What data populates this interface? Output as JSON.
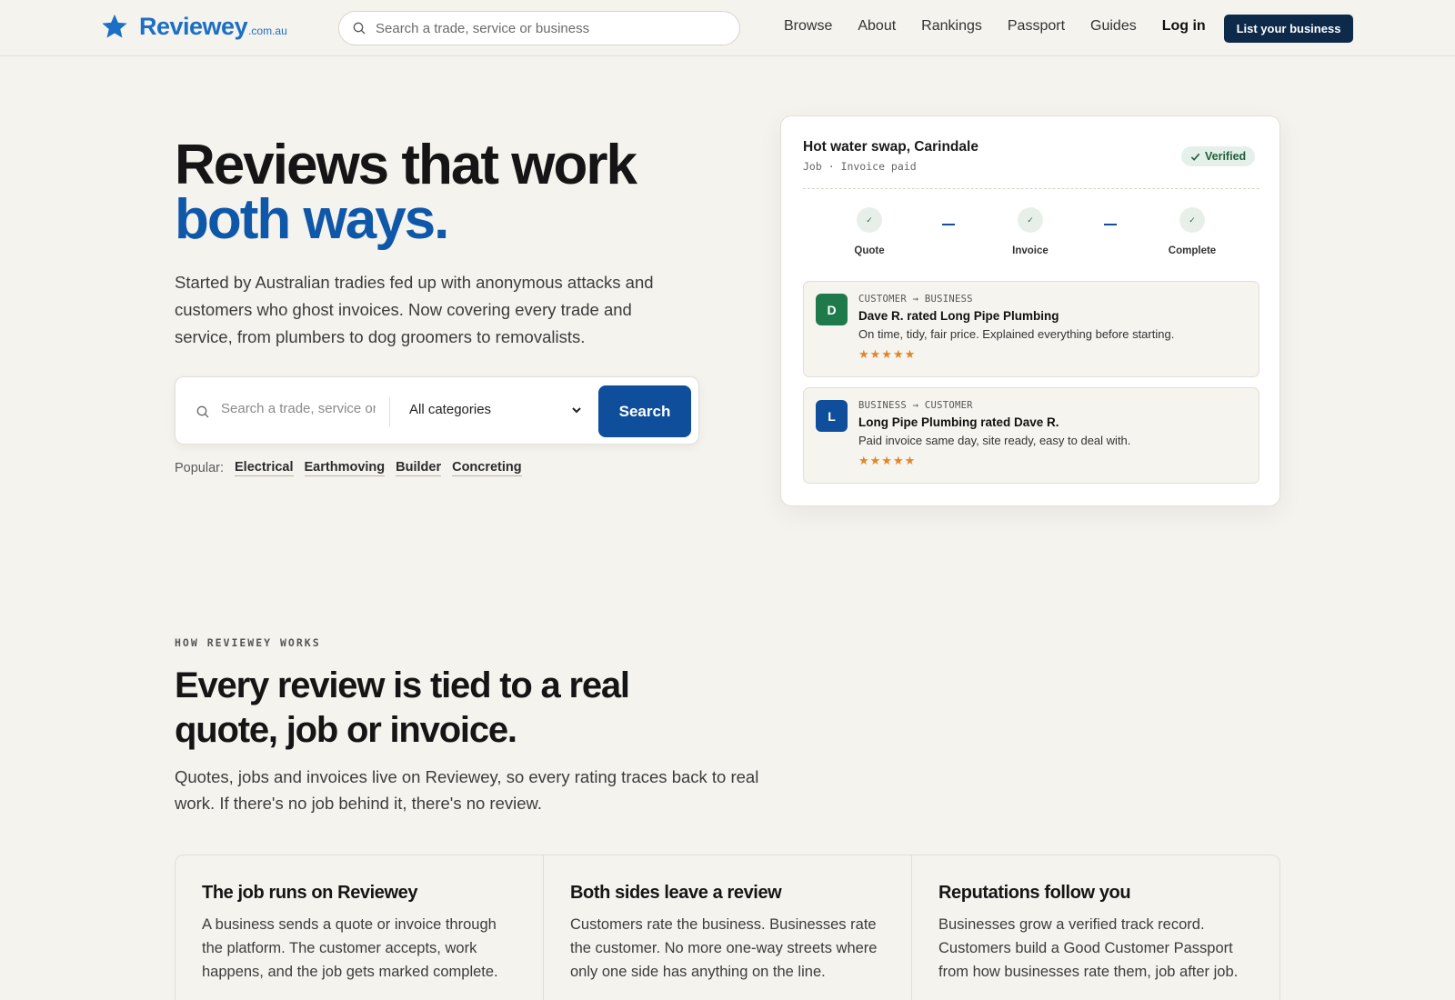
{
  "brand": {
    "name": "Reviewey",
    "tld": ".com.au",
    "color": "#1b6fc4"
  },
  "header": {
    "search_placeholder": "Search a trade, service or business",
    "nav": [
      "Browse",
      "About",
      "Rankings",
      "Passport",
      "Guides"
    ],
    "login": "Log in",
    "cta": "List your business"
  },
  "hero": {
    "title_line1": "Reviews that work",
    "title_line2": "both ways.",
    "subtitle": "Started by Australian tradies fed up with anonymous attacks and customers who ghost invoices. Now covering every trade and service, from plumbers to dog groomers to removalists.",
    "search_placeholder": "Search a trade, service or business",
    "category_selected": "All categories",
    "search_button": "Search",
    "popular_label": "Popular:",
    "popular": [
      "Electrical",
      "Earthmoving",
      "Builder",
      "Concreting"
    ]
  },
  "job_card": {
    "title": "Hot water swap, Carindale",
    "meta": "Job · Invoice paid",
    "badge": "Verified",
    "steps": [
      "Quote",
      "Invoice",
      "Complete"
    ],
    "reviews": [
      {
        "initial": "D",
        "avatar_color": "#1e7a4a",
        "tag": "CUSTOMER → BUSINESS",
        "headline": "Dave R. rated Long Pipe Plumbing",
        "body": "On time, tidy, fair price. Explained everything before starting.",
        "stars": "★★★★★",
        "rating": 5
      },
      {
        "initial": "L",
        "avatar_color": "#0f4e9b",
        "tag": "BUSINESS → CUSTOMER",
        "headline": "Long Pipe Plumbing rated Dave R.",
        "body": "Paid invoice same day, site ready, easy to deal with.",
        "stars": "★★★★★",
        "rating": 5
      }
    ]
  },
  "how": {
    "eyebrow": "HOW REVIEWEY WORKS",
    "title": "Every review is tied to a real quote, job or invoice.",
    "subtitle": "Quotes, jobs and invoices live on Reviewey, so every rating traces back to real work. If there's no job behind it, there's no review.",
    "features": [
      {
        "title": "The job runs on Reviewey",
        "body": "A business sends a quote or invoice through the platform. The customer accepts, work happens, and the job gets marked complete."
      },
      {
        "title": "Both sides leave a review",
        "body": "Customers rate the business. Businesses rate the customer. No more one-way streets where only one side has anything on the line."
      },
      {
        "title": "Reputations follow you",
        "body": "Businesses grow a verified track record. Customers build a Good Customer Passport from how businesses rate them, job after job."
      }
    ]
  }
}
